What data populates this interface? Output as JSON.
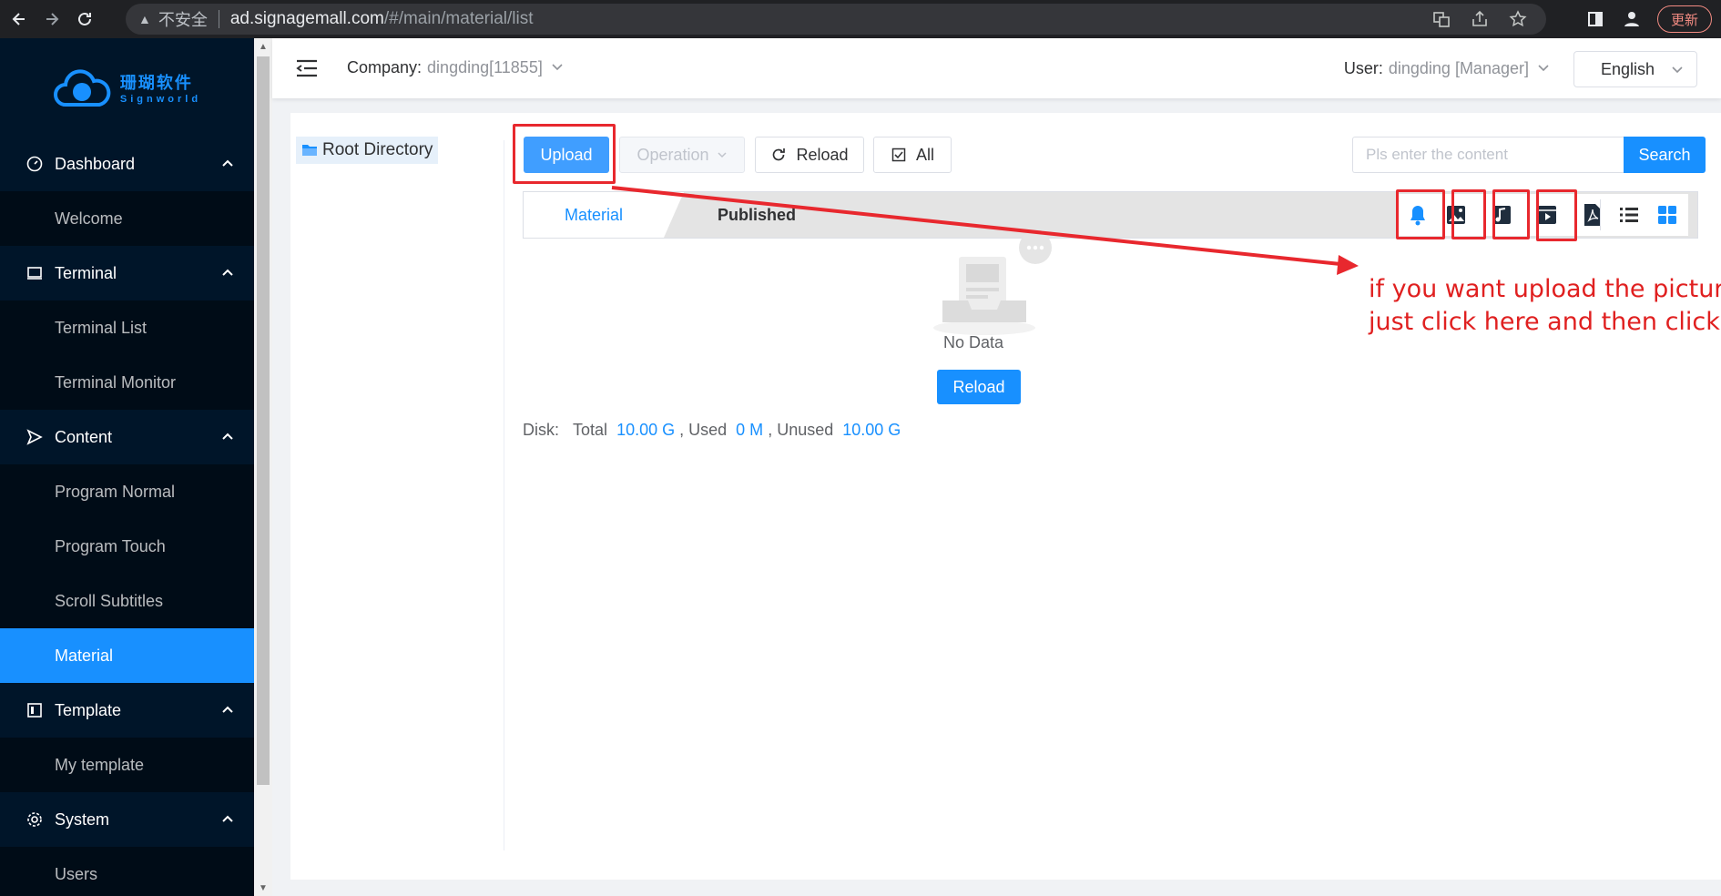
{
  "browser": {
    "security_label": "不安全",
    "url_host": "ad.signagemall.com",
    "url_path": "/#/main/material/list",
    "update_label": "更新"
  },
  "logo": {
    "cn": "珊瑚软件",
    "en": "Signworld"
  },
  "sidebar": {
    "groups": [
      {
        "label": "Dashboard",
        "icon": "dashboard-icon",
        "items": [
          "Welcome"
        ]
      },
      {
        "label": "Terminal",
        "icon": "monitor-icon",
        "items": [
          "Terminal List",
          "Terminal Monitor"
        ]
      },
      {
        "label": "Content",
        "icon": "send-icon",
        "items": [
          "Program Normal",
          "Program Touch",
          "Scroll Subtitles",
          "Material"
        ]
      },
      {
        "label": "Template",
        "icon": "template-icon",
        "items": [
          "My template"
        ]
      },
      {
        "label": "System",
        "icon": "gear-icon",
        "items": [
          "Users"
        ]
      }
    ],
    "active_item": "Material"
  },
  "header": {
    "company_label": "Company:",
    "company_value": "dingding[11855]",
    "user_label": "User:",
    "user_value": "dingding [Manager]",
    "language": "English"
  },
  "tree": {
    "root": "Root Directory"
  },
  "toolbar": {
    "upload": "Upload",
    "operation": "Operation",
    "reload": "Reload",
    "all": "All",
    "search_placeholder": "Pls enter the content",
    "search": "Search"
  },
  "tabs": {
    "material": "Material",
    "published": "Published"
  },
  "filters": [
    "bell-icon",
    "image-icon",
    "music-icon",
    "video-icon",
    "pdf-icon",
    "list-view-icon",
    "grid-view-icon"
  ],
  "empty": {
    "text": "No Data",
    "reload": "Reload"
  },
  "disk": {
    "label": "Disk:",
    "total_label": "Total",
    "total": "10.00 G",
    "used_label": ", Used",
    "used": "0 M",
    "unused_label": ", Unused",
    "unused": "10.00 G"
  },
  "annotation": {
    "line1": "if you want upload the picture/",
    "line2": "just click here and then click up",
    "color": "#e02020"
  },
  "colors": {
    "primary": "#1890ff",
    "sidebar_bg": "#001529",
    "highlight": "#e8282e"
  }
}
